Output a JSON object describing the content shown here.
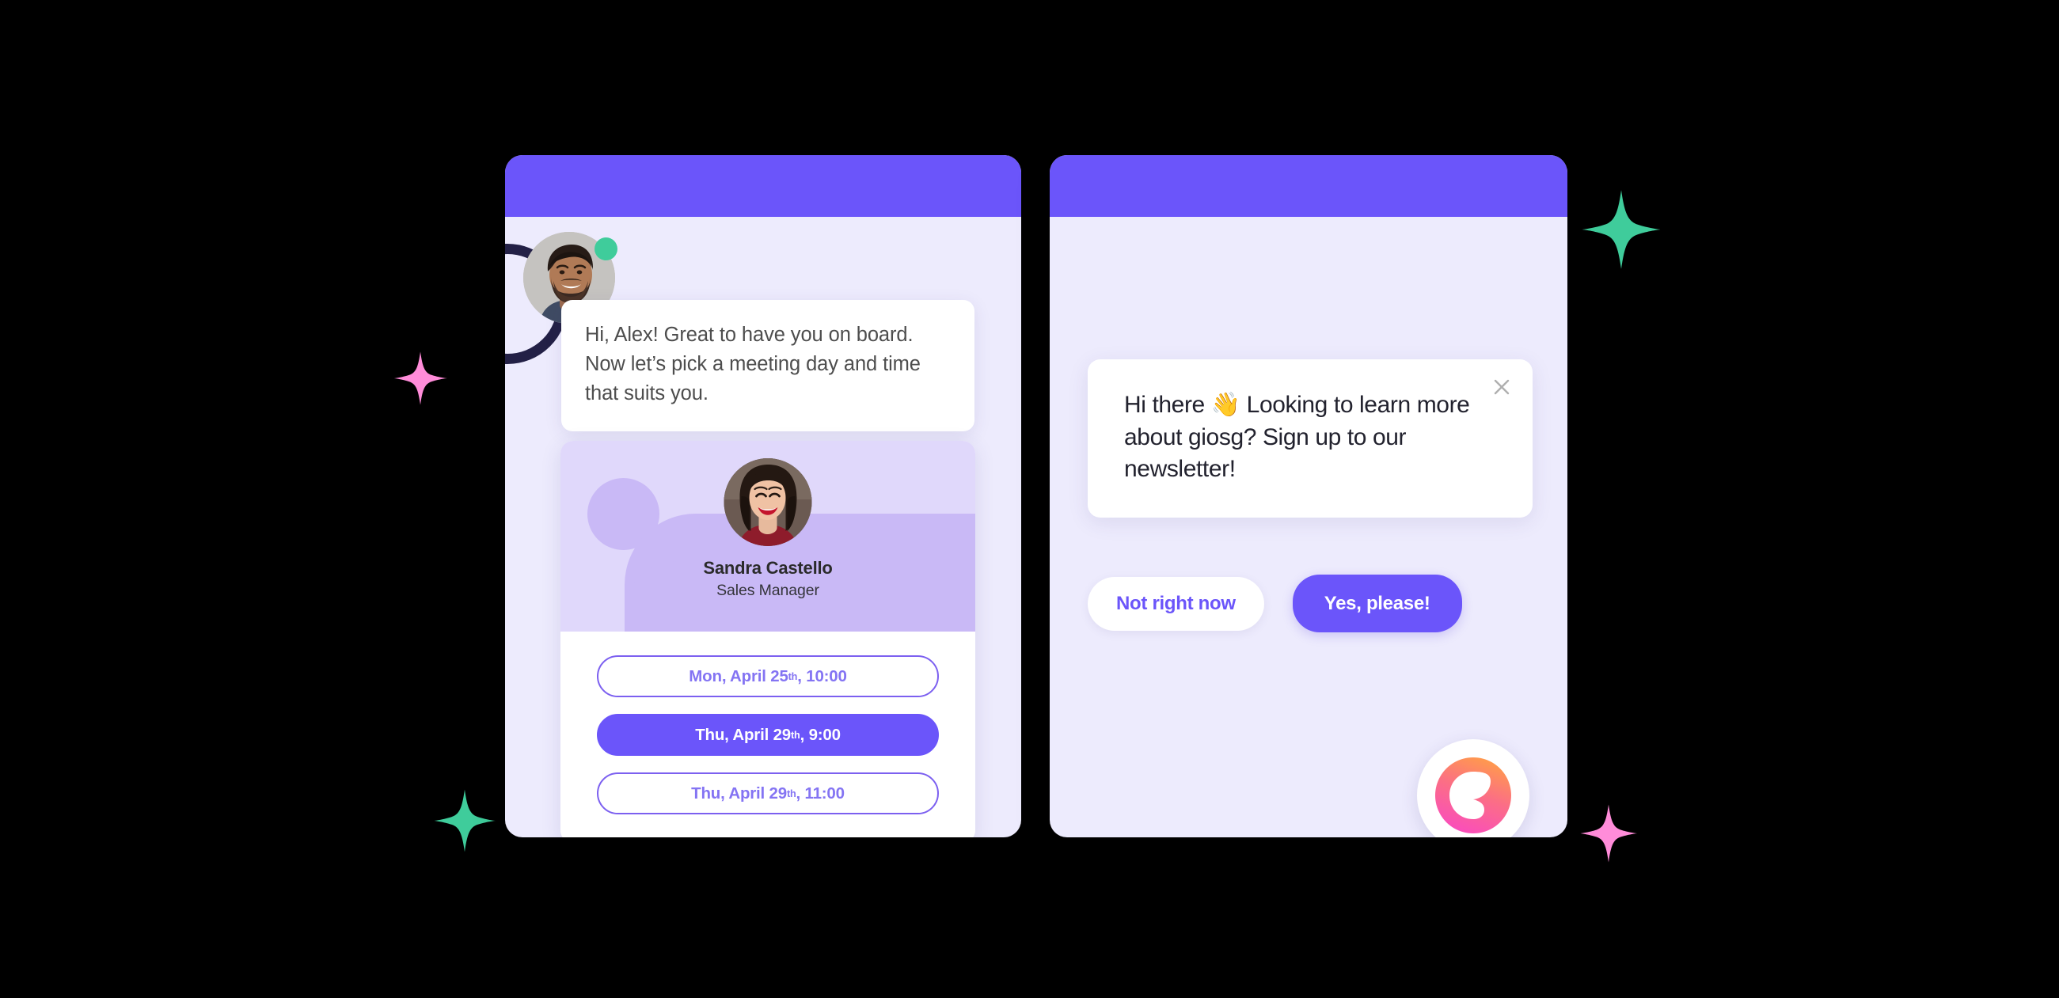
{
  "theme": {
    "background": "#000000",
    "accent_purple": "#6B55FA",
    "panel_body": "#EDEBFD",
    "light_lavender": "#E0D8FB",
    "mid_lavender": "#C9B9F6",
    "status_green": "#3FCC9B",
    "sparkle_green": "#3FCC9B",
    "sparkle_pink": "#FF8CD9",
    "dark_ring": "#232046",
    "slot_outline": "#7C60F0",
    "slot_text": "#8474F3",
    "close_gray": "#AFAFAF"
  },
  "left_panel": {
    "name": "booking-chat-widget",
    "agent": {
      "avatar_name": "agent-avatar",
      "status": "online",
      "status_dot_name": "online-status-dot"
    },
    "message": {
      "text": "Hi, Alex! Great to have you on board. Now let’s pick a meeting day and time that suits you."
    },
    "booking_card": {
      "rep_name": "Sandra Castello",
      "rep_role": "Sales Manager",
      "rep_avatar_name": "sales-manager-avatar",
      "slots": [
        {
          "day": "Mon, April 25",
          "ordinal": "th",
          "time": ", 10:00",
          "selected": false
        },
        {
          "day": "Thu, April 29",
          "ordinal": "th",
          "time": ", 9:00",
          "selected": true
        },
        {
          "day": "Thu, April 29",
          "ordinal": "th",
          "time": ", 11:00",
          "selected": false
        }
      ]
    }
  },
  "right_panel": {
    "name": "newsletter-chat-widget",
    "popup": {
      "text": "Hi there 👋 Looking to learn more about giosg? Sign up to our newsletter!",
      "close_icon": "close-icon"
    },
    "actions": {
      "secondary_label": "Not right now",
      "primary_label": "Yes, please!"
    },
    "launcher": {
      "icon_name": "giosg-logo-icon"
    }
  },
  "decorations": {
    "sparkles": [
      {
        "name": "sparkle-star-green-top-right",
        "color": "#3FCC9B"
      },
      {
        "name": "sparkle-star-pink-left",
        "color": "#FF8CD9"
      },
      {
        "name": "sparkle-star-green-bottom-left",
        "color": "#3FCC9B"
      },
      {
        "name": "sparkle-star-pink-bottom-right",
        "color": "#FF8CD9"
      }
    ]
  }
}
